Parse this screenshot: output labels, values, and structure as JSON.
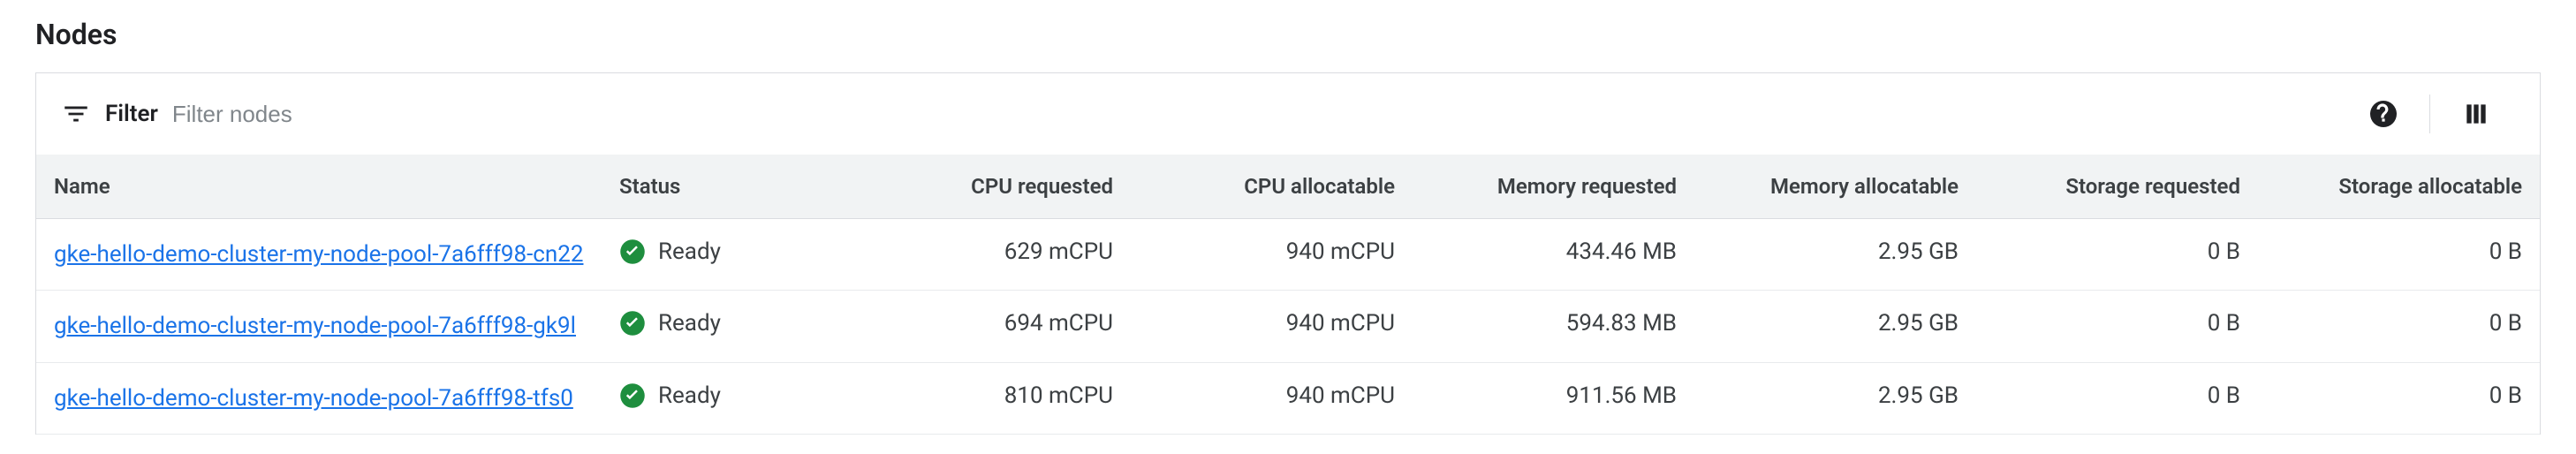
{
  "section": {
    "title": "Nodes"
  },
  "filter": {
    "label": "Filter",
    "placeholder": "Filter nodes"
  },
  "columns": {
    "name": "Name",
    "status": "Status",
    "cpu_req": "CPU requested",
    "cpu_alloc": "CPU allocatable",
    "mem_req": "Memory requested",
    "mem_alloc": "Memory allocatable",
    "stor_req": "Storage requested",
    "stor_alloc": "Storage allocatable"
  },
  "rows": [
    {
      "name": "gke-hello-demo-cluster-my-node-pool-7a6fff98-cn22",
      "status": "Ready",
      "cpu_req": "629 mCPU",
      "cpu_alloc": "940 mCPU",
      "mem_req": "434.46 MB",
      "mem_alloc": "2.95 GB",
      "stor_req": "0 B",
      "stor_alloc": "0 B"
    },
    {
      "name": "gke-hello-demo-cluster-my-node-pool-7a6fff98-gk9l",
      "status": "Ready",
      "cpu_req": "694 mCPU",
      "cpu_alloc": "940 mCPU",
      "mem_req": "594.83 MB",
      "mem_alloc": "2.95 GB",
      "stor_req": "0 B",
      "stor_alloc": "0 B"
    },
    {
      "name": "gke-hello-demo-cluster-my-node-pool-7a6fff98-tfs0",
      "status": "Ready",
      "cpu_req": "810 mCPU",
      "cpu_alloc": "940 mCPU",
      "mem_req": "911.56 MB",
      "mem_alloc": "2.95 GB",
      "stor_req": "0 B",
      "stor_alloc": "0 B"
    }
  ]
}
